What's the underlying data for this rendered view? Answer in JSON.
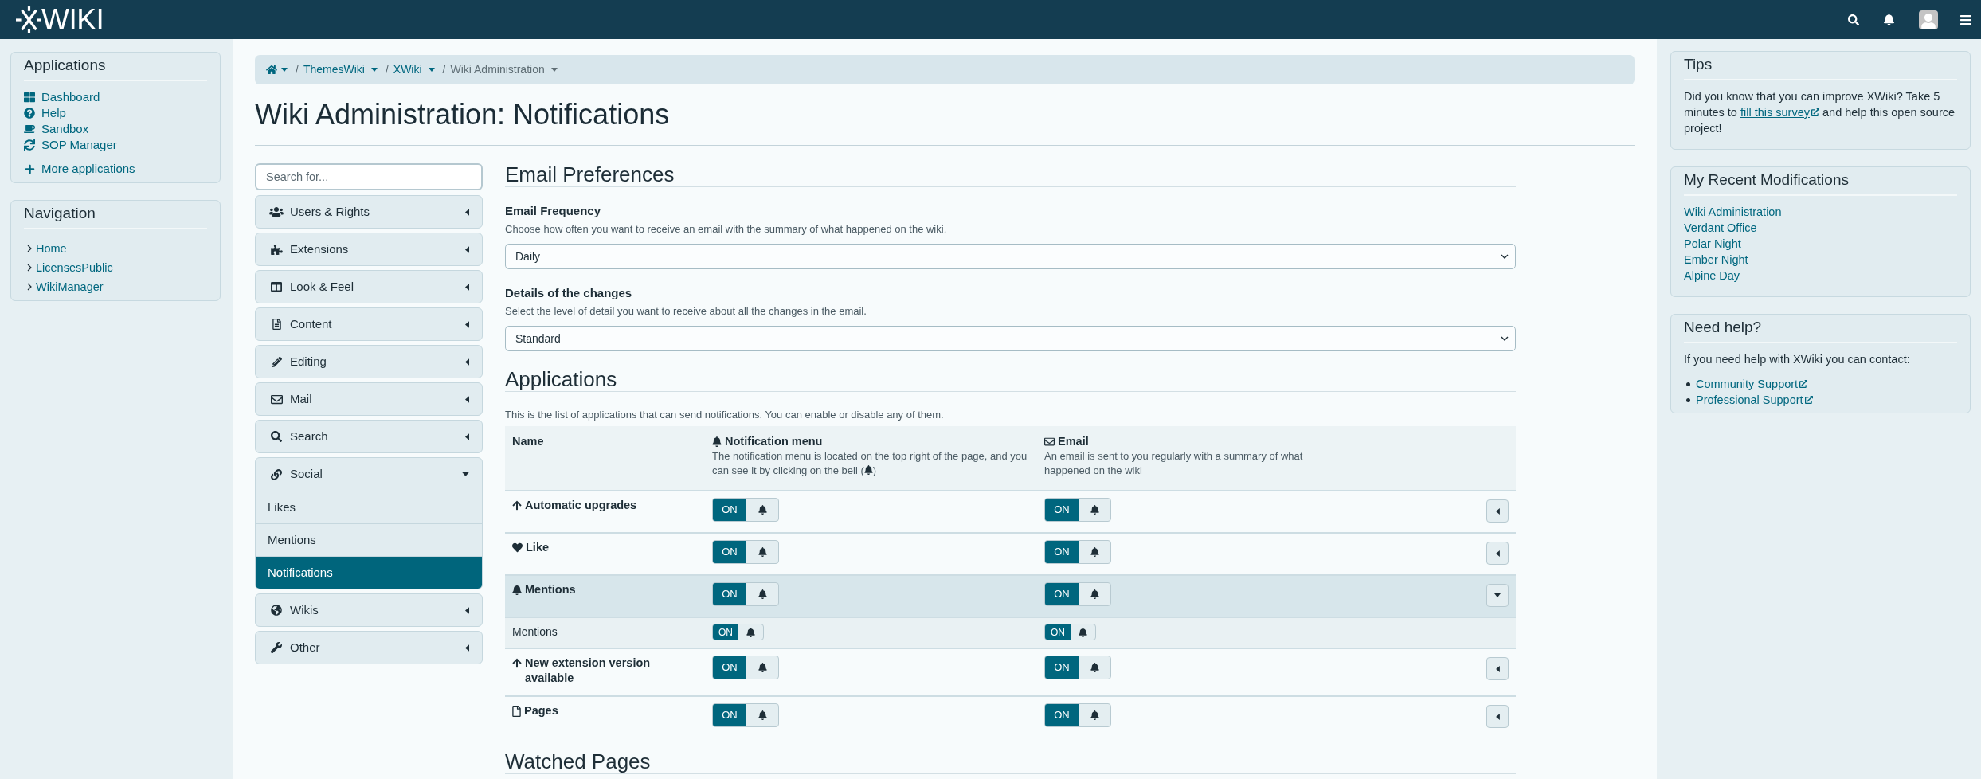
{
  "top_bar": {
    "logo_text": "WIKI"
  },
  "applications_panel": {
    "title": "Applications",
    "items": [
      {
        "label": "Dashboard"
      },
      {
        "label": "Help"
      },
      {
        "label": "Sandbox"
      },
      {
        "label": "SOP Manager"
      }
    ],
    "more_link": "More applications"
  },
  "navigation_panel": {
    "title": "Navigation",
    "items": [
      {
        "label": "Home",
        "expanded": false
      },
      {
        "label": "LicensesPublic",
        "expanded": false
      },
      {
        "label": "WikiManager",
        "expanded": false
      }
    ]
  },
  "breadcrumb": [
    {
      "separator": "/",
      "label": "ThemesWiki"
    },
    {
      "separator": "/",
      "label": "XWiki"
    },
    {
      "separator": "/",
      "label": "Wiki Administration"
    }
  ],
  "title": "Wiki Administration: Notifications",
  "admin_menu": {
    "search": {
      "placeholder": "Search for..."
    },
    "sections": [
      {
        "label": "Users & Rights",
        "expanded": false
      },
      {
        "label": "Extensions",
        "expanded": false
      },
      {
        "label": "Look & Feel",
        "expanded": false
      },
      {
        "label": "Content",
        "expanded": false
      },
      {
        "label": "Editing",
        "expanded": false
      },
      {
        "label": "Mail",
        "expanded": false
      },
      {
        "label": "Search",
        "expanded": false
      },
      {
        "label": "Social",
        "expanded": true,
        "children": [
          {
            "label": "Likes",
            "selected": false
          },
          {
            "label": "Mentions",
            "selected": false
          },
          {
            "label": "Notifications",
            "selected": true
          }
        ]
      },
      {
        "label": "Wikis",
        "expanded": false
      },
      {
        "label": "Other",
        "expanded": false
      }
    ]
  },
  "email_preferences": {
    "heading": "Email Preferences",
    "fields": [
      {
        "label": "Email Frequency",
        "description": "Choose how often you want to receive an email with the summary of what happened on the wiki.",
        "value": "Daily"
      },
      {
        "label": "Details of the changes",
        "description": "Select the level of detail you want to receive about all the changes in the email.",
        "value": "Standard"
      }
    ]
  },
  "applications": {
    "heading": "Applications",
    "description": "This is the list of applications that can send notifications. You can enable or disable any of them.",
    "columns": [
      {
        "label": "Name"
      },
      {
        "label": "Notification menu",
        "description": "The notification menu is located on the top right of the page, and you can see it by clicking on the bell (",
        "description_end": ")"
      },
      {
        "label": "Email",
        "description": "An email is sent to you regularly with a summary of what happened on the wiki"
      }
    ],
    "rows": [
      {
        "name": "Automatic upgrades",
        "notification": {
          "label": "ON",
          "on": true
        },
        "email": {
          "label": "ON",
          "on": true
        },
        "expanded": false
      },
      {
        "name": "Like",
        "notification": {
          "label": "ON",
          "on": true
        },
        "email": {
          "label": "ON",
          "on": true
        },
        "expanded": false
      },
      {
        "name": "Mentions",
        "notification": {
          "label": "ON",
          "on": true
        },
        "email": {
          "label": "ON",
          "on": true
        },
        "expanded": true,
        "children": [
          {
            "name": "Mentions",
            "notification": {
              "label": "ON",
              "on": true
            },
            "email": {
              "label": "ON",
              "on": true
            }
          }
        ]
      },
      {
        "name": "New extension version available",
        "notification": {
          "label": "ON",
          "on": true
        },
        "email": {
          "label": "ON",
          "on": true
        },
        "expanded": false
      },
      {
        "name": "Pages",
        "notification": {
          "label": "ON",
          "on": true
        },
        "email": {
          "label": "ON",
          "on": true
        },
        "expanded": false
      }
    ]
  },
  "watched_pages": {
    "heading": "Watched Pages"
  },
  "tips_panel": {
    "title": "Tips",
    "text_before": "Did you know that you can improve XWiki? Take 5 minutes to",
    "link": "fill this survey",
    "text_after": "and help this open source project!"
  },
  "recent_modifications_panel": {
    "title": "My Recent Modifications",
    "items": [
      "Wiki Administration",
      "Verdant Office",
      "Polar Night",
      "Ember Night",
      "Alpine Day"
    ]
  },
  "help_panel": {
    "title": "Need help?",
    "text": "If you need help with XWiki you can contact:",
    "links": [
      "Community Support",
      "Professional Support"
    ]
  }
}
